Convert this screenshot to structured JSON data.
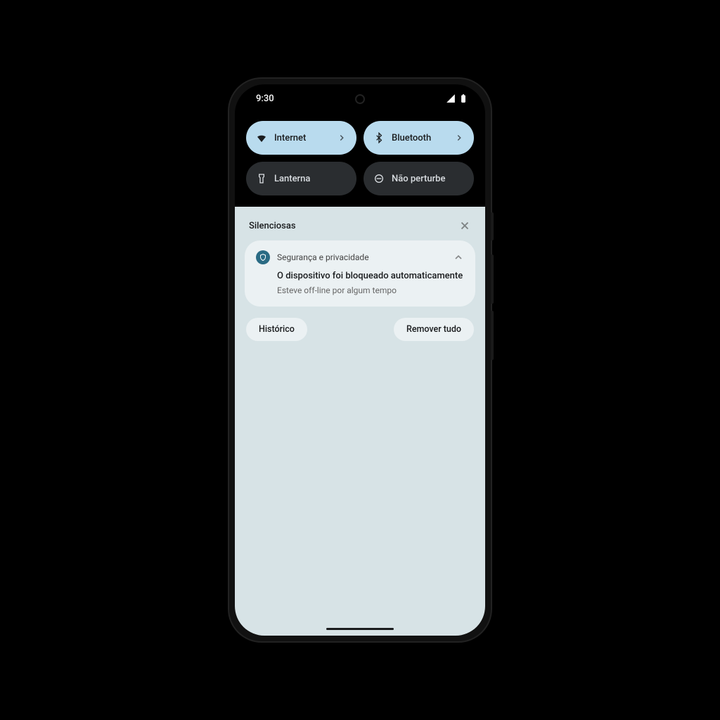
{
  "status": {
    "time": "9:30"
  },
  "qs": {
    "internet": "Internet",
    "bluetooth": "Bluetooth",
    "flashlight": "Lanterna",
    "dnd": "Não perturbe"
  },
  "section": {
    "silent": "Silenciosas"
  },
  "notification": {
    "app": "Segurança e privacidade",
    "title": "O dispositivo foi bloqueado automaticamente",
    "text": "Esteve off-line por algum tempo"
  },
  "actions": {
    "history": "Histórico",
    "clear_all": "Remover tudo"
  }
}
